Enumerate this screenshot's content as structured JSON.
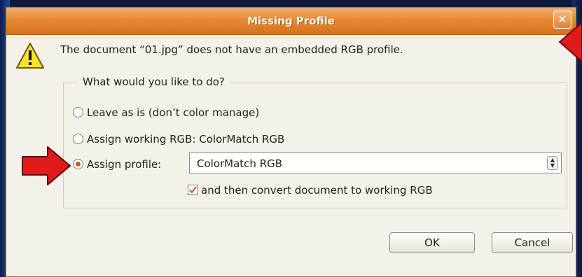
{
  "dialog": {
    "title": "Missing Profile",
    "close_glyph": "✕",
    "message": "The document “01.jpg” does not have an embedded RGB profile.",
    "options": {
      "legend": "What would you like to do?",
      "radios": [
        {
          "label": "Leave as is (don’t color manage)",
          "checked": false
        },
        {
          "label": "Assign working RGB:  ColorMatch RGB",
          "checked": false
        },
        {
          "label": "Assign profile:",
          "checked": true
        }
      ],
      "profile_select": {
        "value": "ColorMatch RGB"
      },
      "convert_checkbox": {
        "label": "and then convert document to working RGB",
        "checked": true
      }
    },
    "buttons": {
      "ok": "OK",
      "cancel": "Cancel"
    }
  },
  "colors": {
    "titlebar": "#e58a36",
    "dialog_bg": "#f3f1ea",
    "annotation_arrow": "#e01b1b",
    "desktop": "#0a1a3c"
  },
  "icons": [
    "warning-icon",
    "close-icon",
    "annotation-arrow"
  ]
}
